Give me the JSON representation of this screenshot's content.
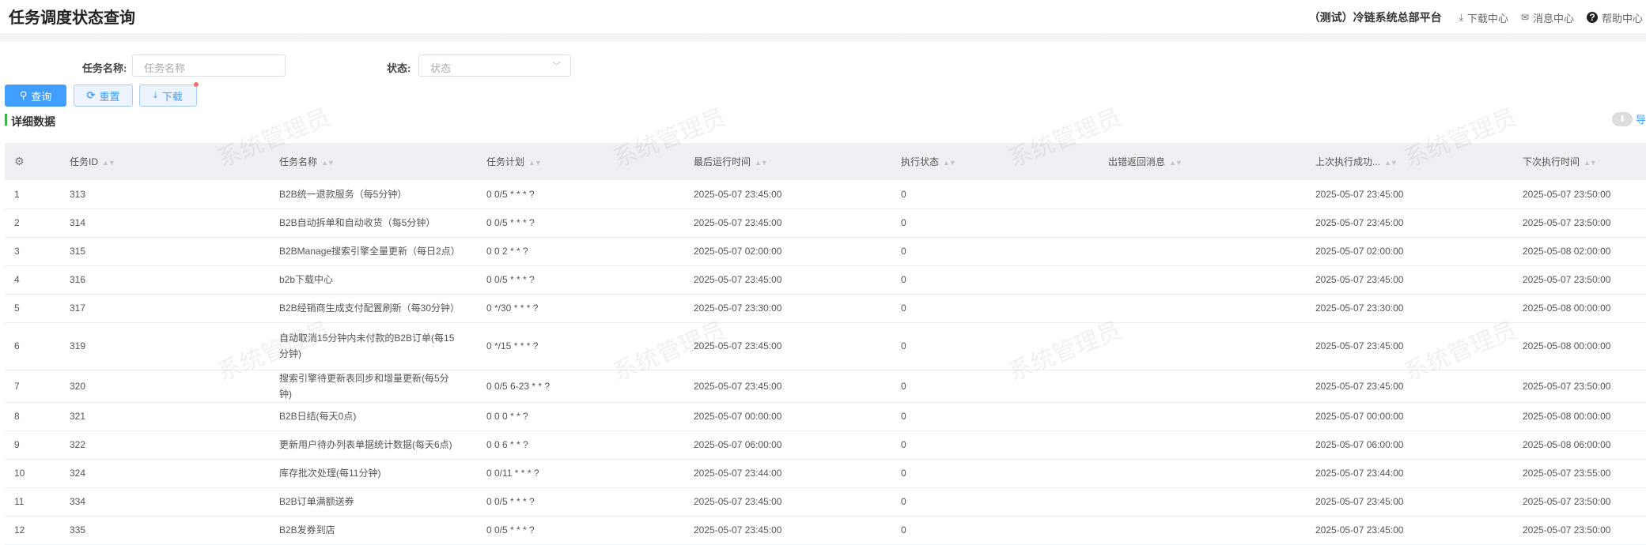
{
  "header": {
    "title": "任务调度状态查询",
    "platform": "（测试）冷链系统总部平台",
    "links": [
      {
        "icon": "download-icon",
        "label": "下载中心"
      },
      {
        "icon": "mail-icon",
        "label": "消息中心"
      },
      {
        "icon": "help-icon",
        "label": "帮助中心"
      }
    ]
  },
  "form": {
    "name_label": "任务名称:",
    "name_placeholder": "任务名称",
    "status_label": "状态:",
    "status_placeholder": "状态"
  },
  "toolbar": {
    "query": "查询",
    "reset": "重置",
    "download": "下载"
  },
  "section": {
    "title": "详细数据",
    "export": "导"
  },
  "watermark": "系统管理员",
  "table": {
    "columns": [
      "任务ID",
      "任务名称",
      "任务计划",
      "最后运行时间",
      "执行状态",
      "出错返回消息",
      "上次执行成功...",
      "下次执行时间"
    ],
    "rows": [
      [
        "1",
        "313",
        "B2B统一退款服务（每5分钟）",
        "0 0/5 * * * ?",
        "2025-05-07 23:45:00",
        "0",
        "",
        "2025-05-07 23:45:00",
        "2025-05-07 23:50:00"
      ],
      [
        "2",
        "314",
        "B2B自动拆单和自动收货（每5分钟）",
        "0 0/5 * * * ?",
        "2025-05-07 23:45:00",
        "0",
        "",
        "2025-05-07 23:45:00",
        "2025-05-07 23:50:00"
      ],
      [
        "3",
        "315",
        "B2BManage搜索引擎全量更新（每日2点）",
        "0 0 2 * * ?",
        "2025-05-07 02:00:00",
        "0",
        "",
        "2025-05-07 02:00:00",
        "2025-05-08 02:00:00"
      ],
      [
        "4",
        "316",
        "b2b下载中心",
        "0 0/5 * * * ?",
        "2025-05-07 23:45:00",
        "0",
        "",
        "2025-05-07 23:45:00",
        "2025-05-07 23:50:00"
      ],
      [
        "5",
        "317",
        "B2B经销商生成支付配置刷新（每30分钟）",
        "0 */30 * * * ?",
        "2025-05-07 23:30:00",
        "0",
        "",
        "2025-05-07 23:30:00",
        "2025-05-08 00:00:00"
      ],
      [
        "6",
        "319",
        "自动取消15分钟内未付款的B2B订单(每15分钟)",
        "0 */15 * * * ?",
        "2025-05-07 23:45:00",
        "0",
        "",
        "2025-05-07 23:45:00",
        "2025-05-08 00:00:00"
      ],
      [
        "7",
        "320",
        "搜索引擎待更新表同步和增量更新(每5分钟)",
        "0 0/5 6-23 * * ?",
        "2025-05-07 23:45:00",
        "0",
        "",
        "2025-05-07 23:45:00",
        "2025-05-07 23:50:00"
      ],
      [
        "8",
        "321",
        "B2B日结(每天0点)",
        "0 0 0 * * ?",
        "2025-05-07 00:00:00",
        "0",
        "",
        "2025-05-07 00:00:00",
        "2025-05-08 00:00:00"
      ],
      [
        "9",
        "322",
        "更新用户待办列表单据统计数据(每天6点)",
        "0 0 6 * * ?",
        "2025-05-07 06:00:00",
        "0",
        "",
        "2025-05-07 06:00:00",
        "2025-05-08 06:00:00"
      ],
      [
        "10",
        "324",
        "库存批次处理(每11分钟)",
        "0 0/11 * * * ?",
        "2025-05-07 23:44:00",
        "0",
        "",
        "2025-05-07 23:44:00",
        "2025-05-07 23:55:00"
      ],
      [
        "11",
        "334",
        "B2B订单满额送券",
        "0 0/5 * * * ?",
        "2025-05-07 23:45:00",
        "0",
        "",
        "2025-05-07 23:45:00",
        "2025-05-07 23:50:00"
      ],
      [
        "12",
        "335",
        "B2B发券到店",
        "0 0/5 * * * ?",
        "2025-05-07 23:45:00",
        "0",
        "",
        "2025-05-07 23:45:00",
        "2025-05-07 23:50:00"
      ]
    ]
  }
}
